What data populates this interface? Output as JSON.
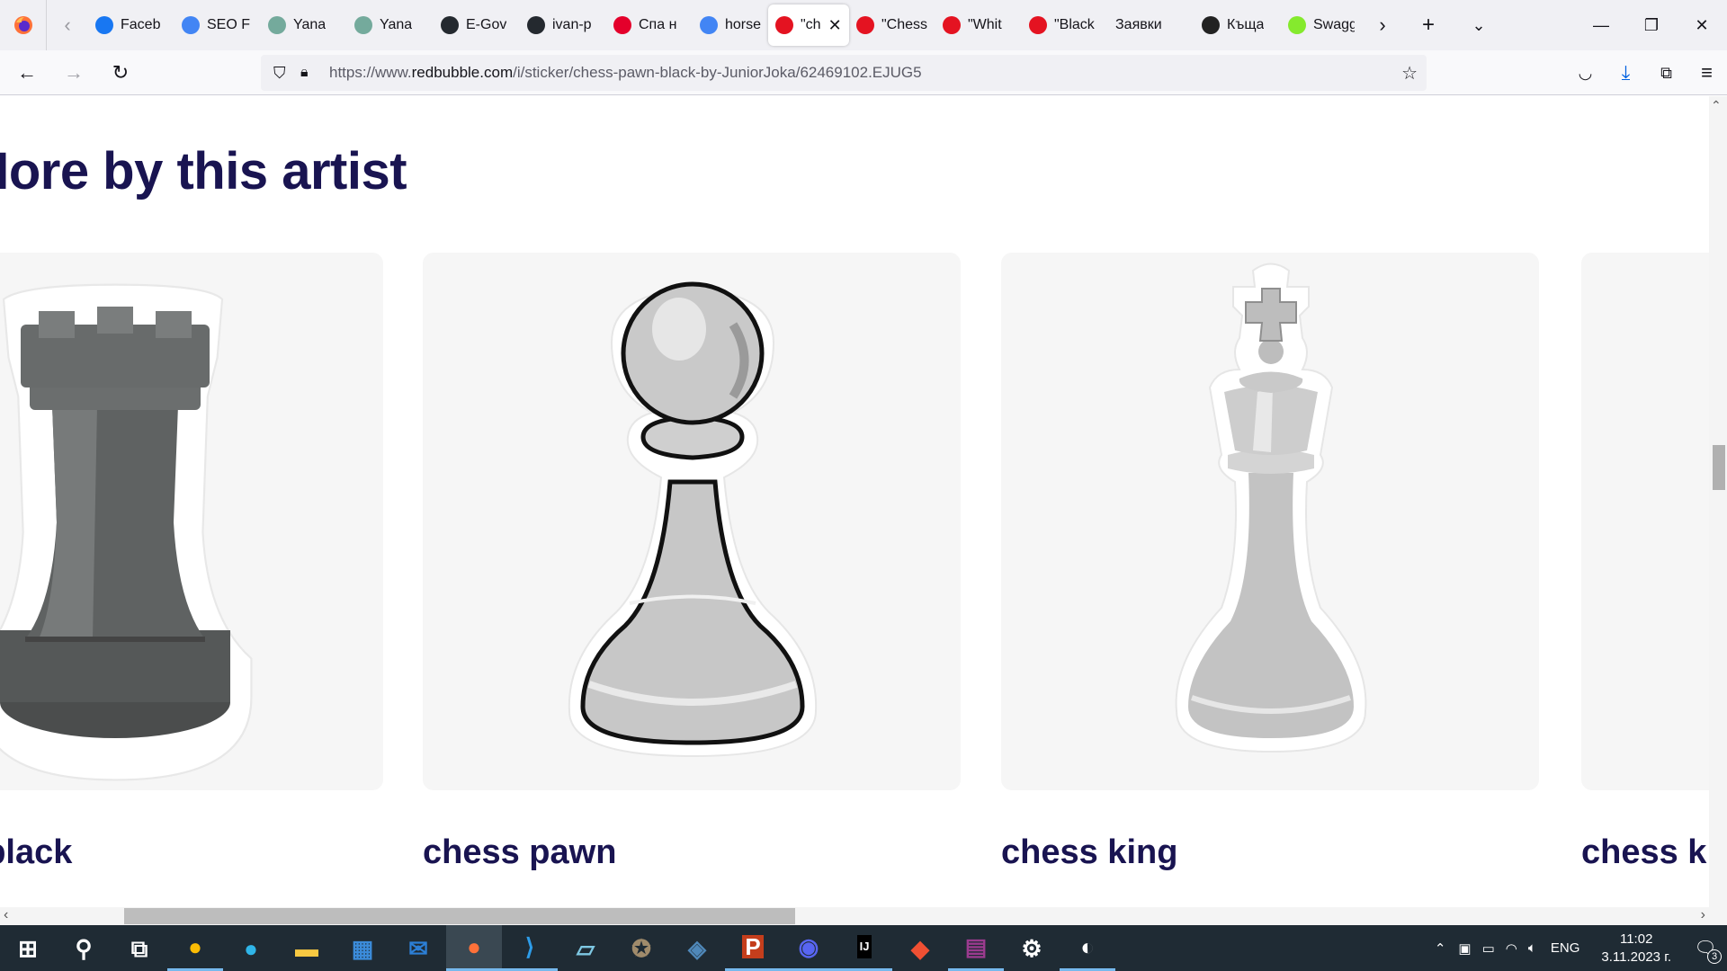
{
  "browser": {
    "tabs": [
      {
        "label": "Faceb",
        "icon": "facebook-icon",
        "color": "#1877f2"
      },
      {
        "label": "SEO F",
        "icon": "google-docs-icon",
        "color": "#4285f4"
      },
      {
        "label": "Yana",
        "icon": "chatgpt-icon",
        "color": "#74aa9c"
      },
      {
        "label": "Yana",
        "icon": "chatgpt-icon",
        "color": "#74aa9c"
      },
      {
        "label": "E-Gov",
        "icon": "github-icon",
        "color": "#24292f"
      },
      {
        "label": "ivan-p",
        "icon": "github-icon",
        "color": "#24292f"
      },
      {
        "label": "Спа н",
        "icon": "allegro-icon",
        "color": "#e4002b"
      },
      {
        "label": "horse",
        "icon": "google-icon",
        "color": "#4285f4"
      },
      {
        "label": "\"ch",
        "icon": "redbubble-icon",
        "color": "#e41321",
        "active": true
      },
      {
        "label": "\"Chess",
        "icon": "redbubble-icon",
        "color": "#e41321"
      },
      {
        "label": "\"Whit",
        "icon": "redbubble-icon",
        "color": "#e41321"
      },
      {
        "label": "\"Black",
        "icon": "redbubble-icon",
        "color": "#e41321"
      },
      {
        "label": "Заявки",
        "icon": "",
        "color": ""
      },
      {
        "label": "Къща",
        "icon": "news-icon",
        "color": "#222222"
      },
      {
        "label": "Swagg",
        "icon": "swagger-icon",
        "color": "#85ea2d"
      }
    ],
    "url": {
      "prefix": "https://www.",
      "host": "redbubble.com",
      "path": "/i/sticker/chess-pawn-black-by-JuniorJoka/62469102.EJUG5"
    }
  },
  "page": {
    "section_title": "More by this artist",
    "products": [
      {
        "title": "chess rook black",
        "piece": "rook",
        "tone": "dark"
      },
      {
        "title": "chess pawn",
        "piece": "pawn",
        "tone": "light"
      },
      {
        "title": "chess king",
        "piece": "king",
        "tone": "light"
      },
      {
        "title": "chess king",
        "piece": "none",
        "tone": "light"
      }
    ]
  },
  "taskbar": {
    "apps": [
      "windows-start-icon",
      "search-icon",
      "task-view-icon",
      "chrome-icon",
      "edge-icon",
      "file-explorer-icon",
      "microsoft-store-icon",
      "mail-icon",
      "firefox-icon",
      "vscode-icon",
      "notepad-icon",
      "gimp-icon",
      "mysql-workbench-icon",
      "powerpoint-icon",
      "discord-icon",
      "intellij-icon",
      "git-icon",
      "winrar-icon",
      "settings-icon",
      "inkscape-icon"
    ],
    "language": "ENG",
    "time": "11:02",
    "date": "3.11.2023 г.",
    "notifications": "3"
  }
}
